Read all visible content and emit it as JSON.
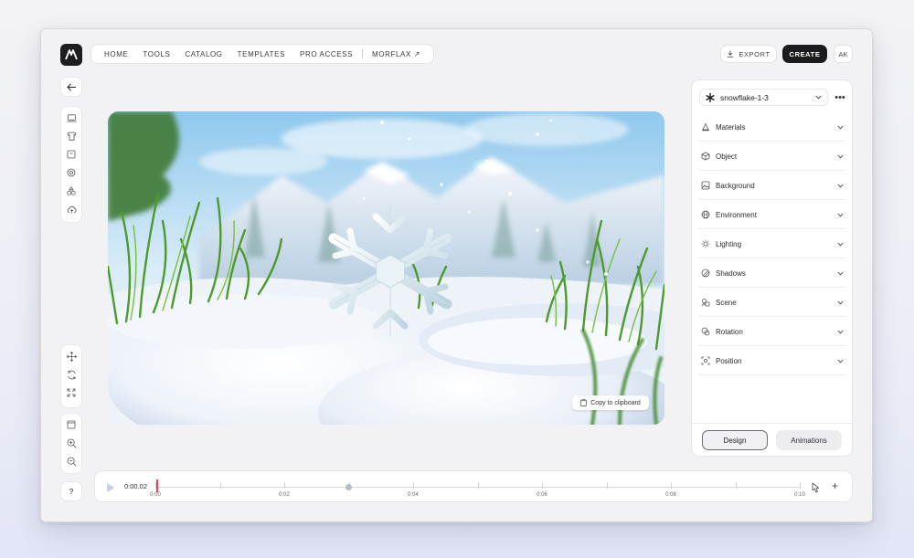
{
  "app": {
    "logo": "morflax-logo"
  },
  "nav": {
    "items": [
      "HOME",
      "TOOLS",
      "CATALOG",
      "TEMPLATES",
      "PRO ACCESS"
    ],
    "external": "MORFLAX ↗"
  },
  "header": {
    "export_label": "EXPORT",
    "create_label": "CREATE",
    "avatar_initials": "AK"
  },
  "canvas": {
    "copy_label": "Copy to clipboard"
  },
  "panel": {
    "object_name": "snowflake-1-3",
    "sections": [
      {
        "label": "Materials",
        "icon": "materials-icon"
      },
      {
        "label": "Object",
        "icon": "cube-icon"
      },
      {
        "label": "Background",
        "icon": "image-icon"
      },
      {
        "label": "Environment",
        "icon": "globe-icon"
      },
      {
        "label": "Lighting",
        "icon": "sun-icon"
      },
      {
        "label": "Shadows",
        "icon": "shadow-icon"
      },
      {
        "label": "Scene",
        "icon": "scene-icon"
      },
      {
        "label": "Rotation",
        "icon": "rotation-icon"
      },
      {
        "label": "Position",
        "icon": "position-icon"
      }
    ],
    "tabs": {
      "design": "Design",
      "animations": "Animations",
      "active": "design"
    }
  },
  "timeline": {
    "current_time": "0:00.02",
    "ticks": [
      "0:00",
      "0:02",
      "0:04",
      "0:06",
      "0:08",
      "0:10"
    ],
    "playhead_fraction": 0.002,
    "keyframe_fraction": 0.3
  },
  "help": {
    "label": "?"
  },
  "colors": {
    "accent": "#1c1c1e",
    "playhead": "#e5484d"
  }
}
